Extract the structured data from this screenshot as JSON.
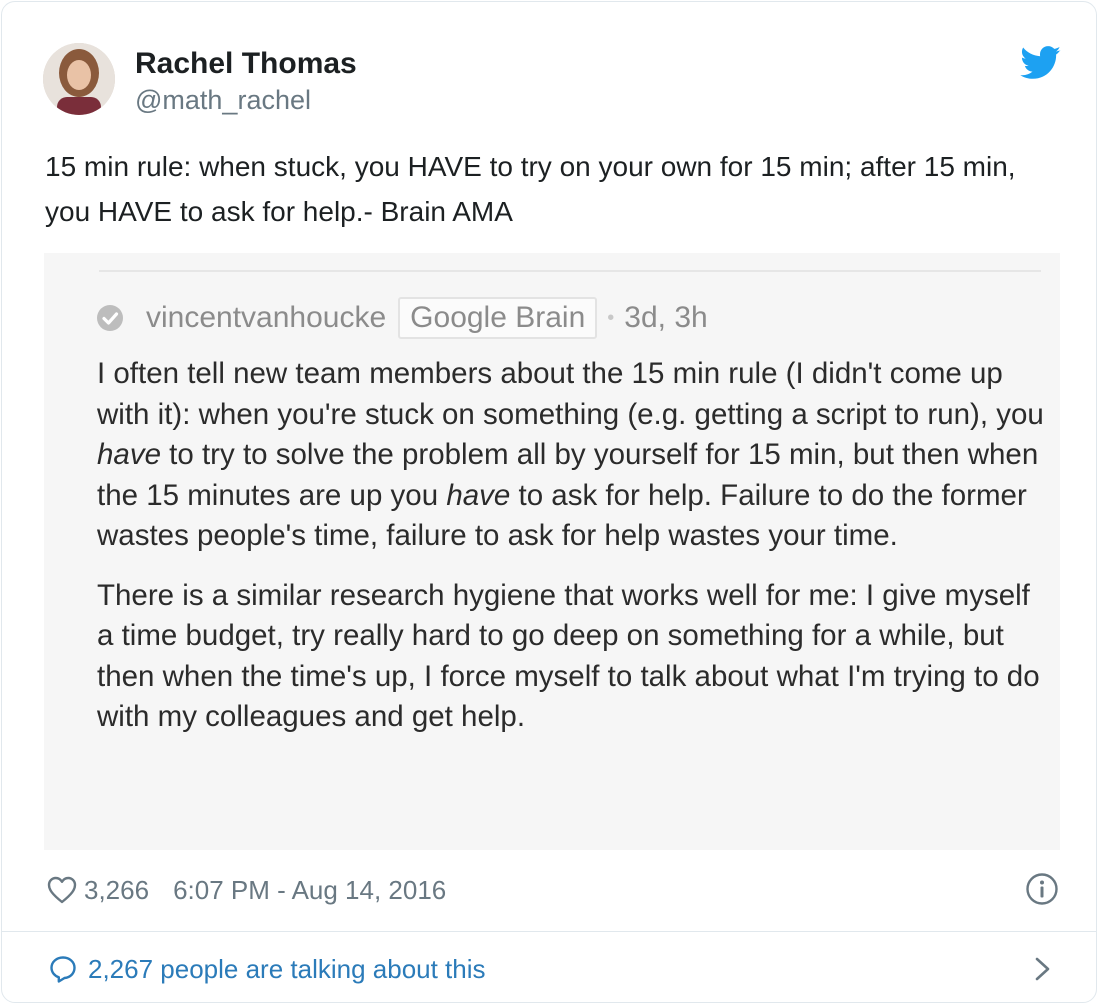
{
  "author": {
    "name": "Rachel Thomas",
    "handle": "@math_rachel"
  },
  "icons": {
    "brand": "twitter-bird-icon",
    "like": "heart-icon",
    "info": "info-icon",
    "reply": "speech-bubble-icon",
    "more": "chevron-right-icon",
    "verified_answer": "check-circle-icon"
  },
  "colors": {
    "brand_blue": "#1da1f2",
    "link_blue": "#2b7bb9",
    "meta_gray": "#697882"
  },
  "tweet": {
    "text": "15 min rule: when stuck, you HAVE to try on your own for 15 min; after 15 min, you HAVE to ask for help.- Brain AMA"
  },
  "media": {
    "username": "vincentvanhoucke",
    "tag": "Google Brain",
    "time": "3d, 3h",
    "p1_a": "I often tell new team members about the 15 min rule (I didn't come up with it): when you're stuck on something (e.g. getting a script to run), you ",
    "p1_em1": "have",
    "p1_b": " to try to solve the problem all by yourself for 15 min, but then when the 15 minutes are up you ",
    "p1_em2": "have",
    "p1_c": " to ask for help. Failure to do the former wastes people's time, failure to ask for help wastes your time.",
    "p2": "There is a similar research hygiene that works well for me: I give myself a time budget, try really hard to go deep on something for a while, but then when the time's up, I force myself to talk about what I'm trying to do with my colleagues and get help."
  },
  "footer": {
    "likes": "3,266",
    "timestamp": "6:07 PM - Aug 14, 2016",
    "talking": "2,267 people are talking about this"
  }
}
